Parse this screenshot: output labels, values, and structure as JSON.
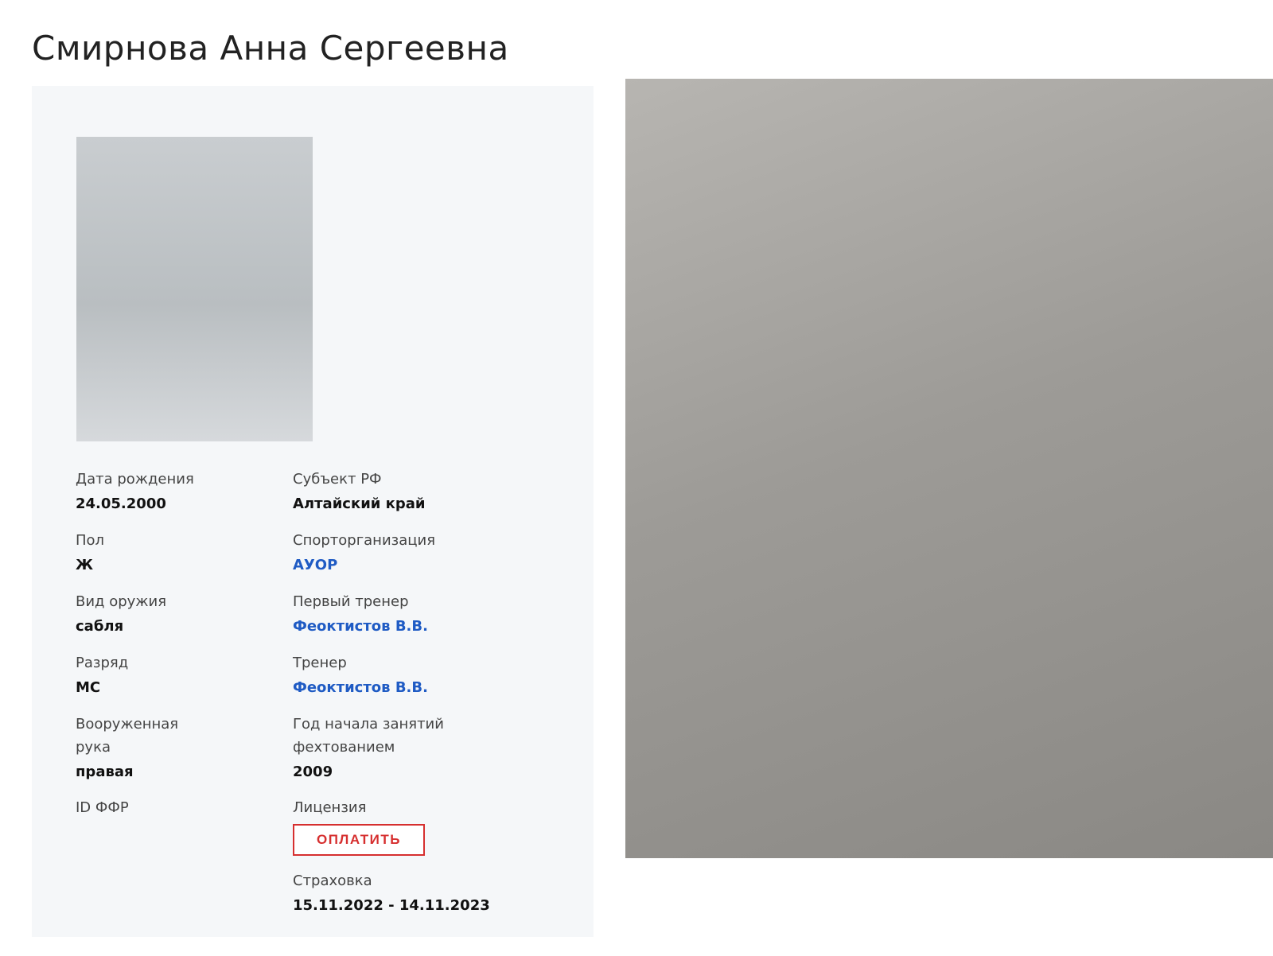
{
  "profile": {
    "name": "Смирнова Анна Сергеевна"
  },
  "fields_left": {
    "birth_label": "Дата рождения",
    "birth_value": "24.05.2000",
    "gender_label": "Пол",
    "gender_value": "Ж",
    "weapon_label": "Вид оружия",
    "weapon_value": "сабля",
    "rank_label": "Разряд",
    "rank_value": "МС",
    "hand_label": "Вооруженная рука",
    "hand_value": "правая",
    "id_label": "ID ФФР"
  },
  "fields_right": {
    "region_label": "Субъект РФ",
    "region_value": "Алтайский край",
    "org_label": "Спорторганизация",
    "org_value": "АУОР",
    "first_coach_label": "Первый тренер",
    "first_coach_value": "Феоктистов В.В.",
    "coach_label": "Тренер",
    "coach_value": "Феоктистов В.В.",
    "start_year_label": "Год начала занятий фехтованием",
    "start_year_value": "2009",
    "license_label": "Лицензия",
    "license_button": "ОПЛАТИТЬ",
    "insurance_label": "Страховка",
    "insurance_value": "15.11.2022 - 14.11.2023"
  },
  "colors": {
    "link": "#1f5bc4",
    "button": "#d62f2f",
    "card_bg": "#f5f7f9"
  }
}
